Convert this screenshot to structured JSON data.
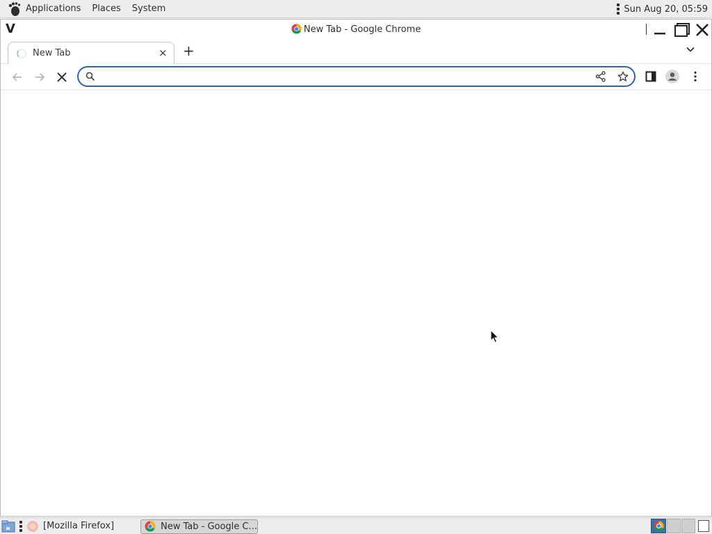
{
  "top_panel": {
    "menus": [
      "Applications",
      "Places",
      "System"
    ],
    "clock": "Sun Aug 20, 05:59"
  },
  "window": {
    "title": "New Tab - Google Chrome",
    "app_letter": "V"
  },
  "tab": {
    "label": "New Tab",
    "close_symbol": "×",
    "new_tab_symbol": "+"
  },
  "toolbar": {
    "omnibox_value": ""
  },
  "taskbar": {
    "firefox_label": "[Mozilla Firefox]",
    "chrome_label": "New Tab - Google C..."
  },
  "colors": {
    "accent": "#2a64b5",
    "panel_bg": "#ededed"
  }
}
